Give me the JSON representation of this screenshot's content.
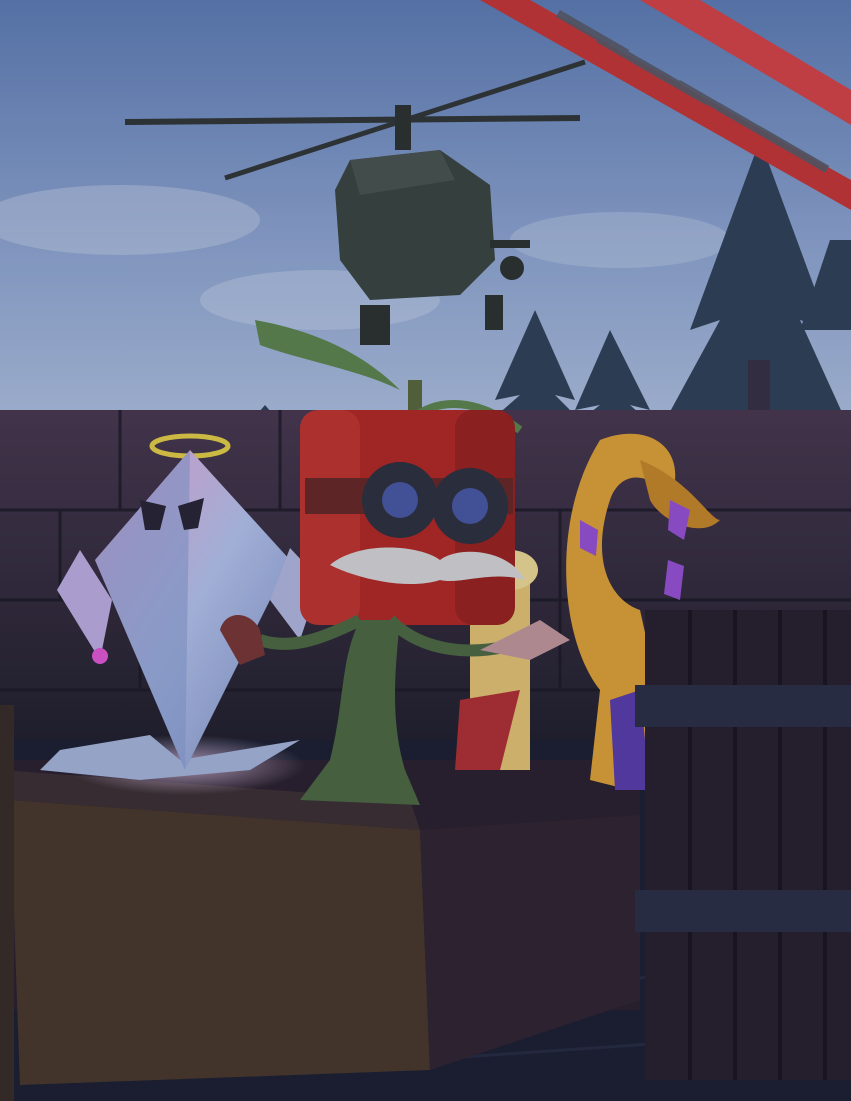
{
  "scene": {
    "sky_colors": [
      "#5f7fb8",
      "#8fa7d4",
      "#b9cbe8"
    ],
    "wall_color": "#2e2a3d",
    "floor_color": "#1e2234",
    "crate_color": "#4a3a2e",
    "rail_color": "#c9383a"
  },
  "characters": {
    "crystal": {
      "color": "#b6c6f0",
      "accent": "#e35bd8",
      "halo": "#e6d24a"
    },
    "tomato": {
      "color": "#b42b27",
      "goggles": "#2f3340",
      "mustache": "#d9d9dc",
      "stem": "#4f6b45"
    },
    "banana": {
      "color": "#e2a43a",
      "gem": "#9a54d8"
    },
    "helicopter": {
      "color": "#3b4744"
    }
  }
}
